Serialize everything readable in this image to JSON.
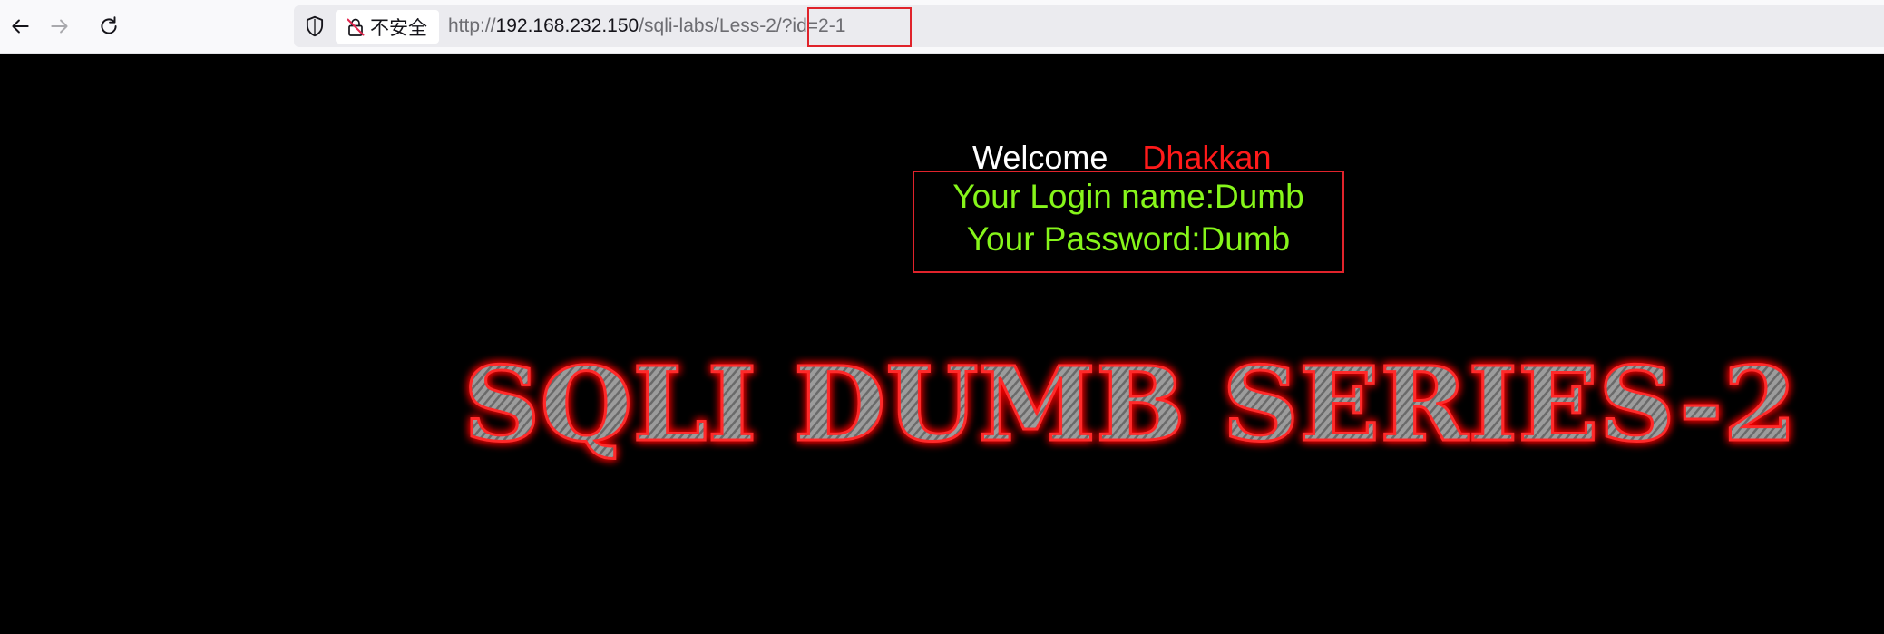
{
  "browser": {
    "insecure_label": "不安全",
    "url": {
      "scheme": "http://",
      "host": "192.168.232.150",
      "path": "/sqli-labs/Less-2/",
      "query": "?id=2-1"
    }
  },
  "page": {
    "welcome": "Welcome",
    "user_name": "Dhakkan",
    "login_line": "Your Login name:Dumb",
    "password_line": "Your Password:Dumb",
    "banner": "SQLI DUMB SERIES-2"
  },
  "colors": {
    "background": "#000000",
    "welcome": "#ffffff",
    "name": "#ff1a1a",
    "result_text": "#86f51a",
    "highlight_box": "#e0232b",
    "banner_glow": "#ff0000"
  }
}
